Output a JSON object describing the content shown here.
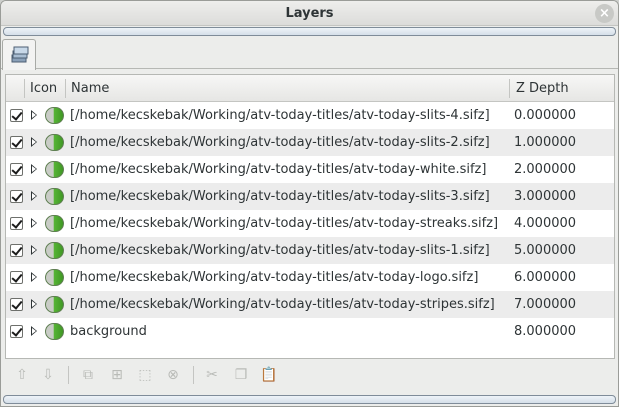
{
  "window": {
    "title": "Layers",
    "close_glyph": "×"
  },
  "progress": {
    "top_fill": 0,
    "bottom_fill": 0
  },
  "tabs": [
    {
      "icon": "layers-stack-icon",
      "selected": true
    }
  ],
  "columns": {
    "visible": "",
    "icon": "Icon",
    "name": "Name",
    "zdepth": "Z Depth"
  },
  "layers": [
    {
      "checked": true,
      "name": "[/home/kecskebak/Working/atv-today-titles/atv-today-slits-4.sifz]",
      "zdepth": "0.000000"
    },
    {
      "checked": true,
      "name": "[/home/kecskebak/Working/atv-today-titles/atv-today-slits-2.sifz]",
      "zdepth": "1.000000"
    },
    {
      "checked": true,
      "name": "[/home/kecskebak/Working/atv-today-titles/atv-today-white.sifz]",
      "zdepth": "2.000000"
    },
    {
      "checked": true,
      "name": "[/home/kecskebak/Working/atv-today-titles/atv-today-slits-3.sifz]",
      "zdepth": "3.000000"
    },
    {
      "checked": true,
      "name": "[/home/kecskebak/Working/atv-today-titles/atv-today-streaks.sifz]",
      "zdepth": "4.000000"
    },
    {
      "checked": true,
      "name": "[/home/kecskebak/Working/atv-today-titles/atv-today-slits-1.sifz]",
      "zdepth": "5.000000"
    },
    {
      "checked": true,
      "name": "[/home/kecskebak/Working/atv-today-titles/atv-today-logo.sifz]",
      "zdepth": "6.000000"
    },
    {
      "checked": true,
      "name": "[/home/kecskebak/Working/atv-today-titles/atv-today-stripes.sifz]",
      "zdepth": "7.000000"
    },
    {
      "checked": true,
      "name": "background",
      "zdepth": "8.000000"
    }
  ],
  "toolbar": [
    {
      "name": "raise-layer-button",
      "glyph": "⇧"
    },
    {
      "name": "lower-layer-button",
      "glyph": "⇩"
    },
    {
      "name": "duplicate-layer-button",
      "glyph": "⧉"
    },
    {
      "name": "encapsulate-layer-button",
      "glyph": "⊞"
    },
    {
      "name": "select-all-children-button",
      "glyph": "⬚"
    },
    {
      "name": "delete-layer-button",
      "glyph": "⊗"
    },
    {
      "name": "cut-button",
      "glyph": "✂"
    },
    {
      "name": "copy-button",
      "glyph": "❐"
    },
    {
      "name": "paste-button",
      "glyph": "📋"
    }
  ],
  "colors": {
    "selection": "#4a90d9",
    "layer_icon_green": "#4caf2f",
    "row_alt": "#ececec"
  }
}
